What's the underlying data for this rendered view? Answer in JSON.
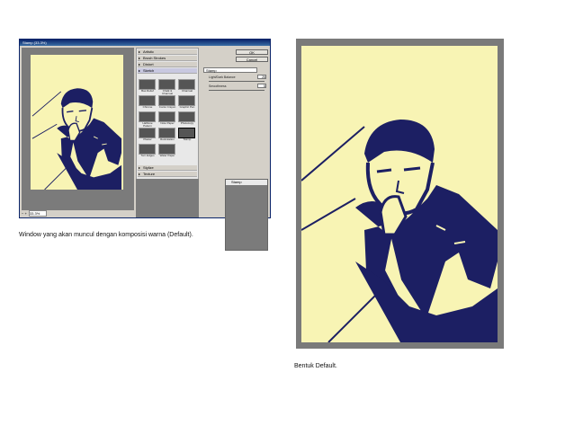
{
  "dialog": {
    "title": "Stamp (33.3%)",
    "zoom_value": "33.3%",
    "filter_categories_top": [
      "Artistic",
      "Brush Strokes",
      "Distort",
      "Sketch"
    ],
    "filter_categories_bottom": [
      "Stylize",
      "Texture"
    ],
    "sketch_filters": [
      "Bas Relief",
      "Chalk & Charcoal",
      "Charcoal",
      "Chrome",
      "Conté Crayon",
      "Graphic Pen",
      "Halftone Pattern",
      "Note Paper",
      "Photocopy",
      "Plaster",
      "Reticulation",
      "Stamp",
      "Torn Edges",
      "Water Paper"
    ],
    "ok_label": "OK",
    "cancel_label": "Cancel",
    "filter_select": "Stamp",
    "light_dark_label": "Light/Dark Balance",
    "light_dark_value": "25",
    "smoothness_label": "Smoothness",
    "smoothness_value": "5",
    "layer_label": "Stamp",
    "colors": {
      "dark": "#1c1f63",
      "light": "#f8f4b4"
    }
  },
  "caption_left": "Window yang akan muncul dengan komposisi warna (Default).",
  "caption_right": "Bentuk Default."
}
